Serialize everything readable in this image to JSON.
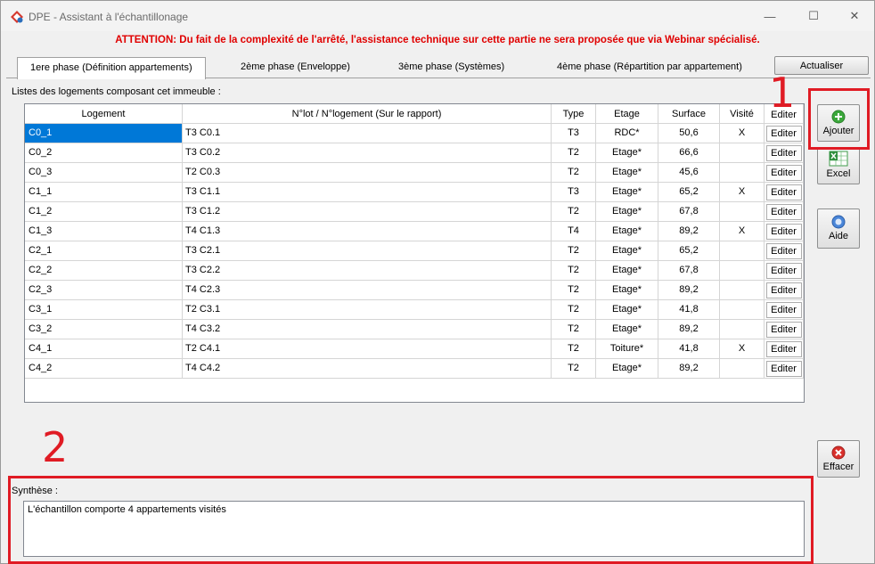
{
  "window": {
    "title": "DPE - Assistant à l'échantillonage",
    "minimize_glyph": "—",
    "maximize_glyph": "☐",
    "close_glyph": "✕"
  },
  "warning": "ATTENTION: Du fait de la complexité de l'arrêté, l'assistance technique sur cette partie ne sera proposée que via Webinar spécialisé.",
  "tabs": [
    {
      "label": "1ere phase (Définition appartements)",
      "active": true
    },
    {
      "label": "2ème phase (Enveloppe)",
      "active": false
    },
    {
      "label": "3ème phase (Systèmes)",
      "active": false
    },
    {
      "label": "4ème phase (Répartition par appartement)",
      "active": false
    }
  ],
  "refresh_label": "Actualiser",
  "list_label": "Listes des logements composant cet immeuble :",
  "columns": [
    "Logement",
    "N°lot / N°logement (Sur le rapport)",
    "Type",
    "Etage",
    "Surface",
    "Visité",
    "Editer"
  ],
  "rows": [
    {
      "logement": "C0_1",
      "lot": "T3 C0.1",
      "type": "T3",
      "etage": "RDC*",
      "surface": "50,6",
      "visite": "X",
      "edit": "Editer"
    },
    {
      "logement": "C0_2",
      "lot": "T3 C0.2",
      "type": "T2",
      "etage": "Etage*",
      "surface": "66,6",
      "visite": "",
      "edit": "Editer"
    },
    {
      "logement": "C0_3",
      "lot": "T2 C0.3",
      "type": "T2",
      "etage": "Etage*",
      "surface": "45,6",
      "visite": "",
      "edit": "Editer"
    },
    {
      "logement": "C1_1",
      "lot": "T3 C1.1",
      "type": "T3",
      "etage": "Etage*",
      "surface": "65,2",
      "visite": "X",
      "edit": "Editer"
    },
    {
      "logement": "C1_2",
      "lot": "T3 C1.2",
      "type": "T2",
      "etage": "Etage*",
      "surface": "67,8",
      "visite": "",
      "edit": "Editer"
    },
    {
      "logement": "C1_3",
      "lot": "T4 C1.3",
      "type": "T4",
      "etage": "Etage*",
      "surface": "89,2",
      "visite": "X",
      "edit": "Editer"
    },
    {
      "logement": "C2_1",
      "lot": "T3 C2.1",
      "type": "T2",
      "etage": "Etage*",
      "surface": "65,2",
      "visite": "",
      "edit": "Editer"
    },
    {
      "logement": "C2_2",
      "lot": "T3 C2.2",
      "type": "T2",
      "etage": "Etage*",
      "surface": "67,8",
      "visite": "",
      "edit": "Editer"
    },
    {
      "logement": "C2_3",
      "lot": "T4 C2.3",
      "type": "T2",
      "etage": "Etage*",
      "surface": "89,2",
      "visite": "",
      "edit": "Editer"
    },
    {
      "logement": "C3_1",
      "lot": "T2 C3.1",
      "type": "T2",
      "etage": "Etage*",
      "surface": "41,8",
      "visite": "",
      "edit": "Editer"
    },
    {
      "logement": "C3_2",
      "lot": "T4 C3.2",
      "type": "T2",
      "etage": "Etage*",
      "surface": "89,2",
      "visite": "",
      "edit": "Editer"
    },
    {
      "logement": "C4_1",
      "lot": "T2 C4.1",
      "type": "T2",
      "etage": "Toiture*",
      "surface": "41,8",
      "visite": "X",
      "edit": "Editer"
    },
    {
      "logement": "C4_2",
      "lot": "T4 C4.2",
      "type": "T2",
      "etage": "Etage*",
      "surface": "89,2",
      "visite": "",
      "edit": "Editer"
    }
  ],
  "side_buttons": {
    "add": "Ajouter",
    "excel": "Excel",
    "help": "Aide",
    "clear": "Effacer"
  },
  "annotations": {
    "one": "1",
    "two": "2"
  },
  "synthese": {
    "label": "Synthèse :",
    "text": "L'échantillon comporte 4 appartements visités"
  },
  "colors": {
    "warning": "#e00000",
    "annotation": "#e01b24",
    "selection": "#0078d7"
  }
}
